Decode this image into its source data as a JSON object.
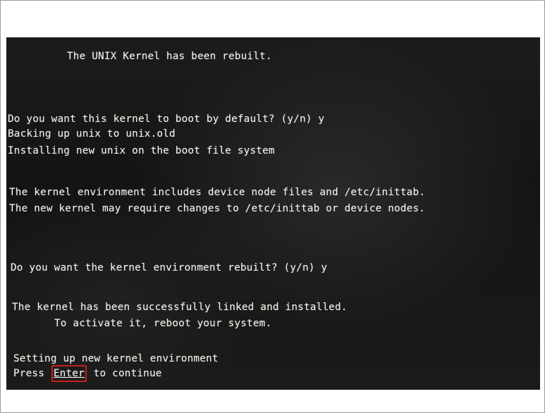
{
  "terminal": {
    "title_line": "The UNIX Kernel has been rebuilt.",
    "boot_prompt": "Do you want this kernel to boot by default? (y/n) y",
    "backup_line": "Backing up unix to unix.old",
    "install_line": "Installing new unix on the boot file system",
    "env_info_1": "The kernel environment includes device node files and /etc/inittab.",
    "env_info_2": "The new kernel may require changes to /etc/inittab or device nodes.",
    "rebuild_prompt": "Do you want the kernel environment rebuilt? (y/n) y",
    "success_1": "The kernel has been successfully linked and installed.",
    "success_2": "To activate it, reboot your system.",
    "setup_line": "Setting up new kernel environment",
    "press_prefix": "Press",
    "press_key": "Enter",
    "press_suffix": "to continue"
  },
  "colors": {
    "terminal_background": "#161615",
    "terminal_text": "#f2f2ee",
    "highlight_border": "#c81f1f"
  }
}
